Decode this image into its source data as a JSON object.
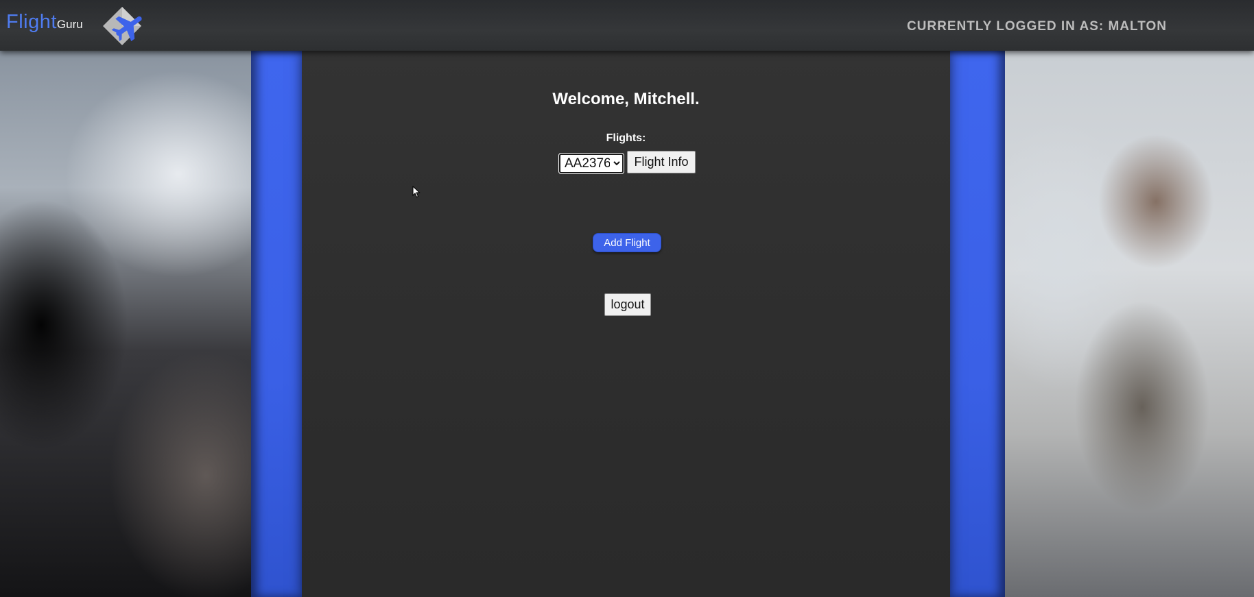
{
  "header": {
    "brand_main": "Flight",
    "brand_sub": "Guru",
    "logo_icon": "plane-logo-icon",
    "logged_in_text": "CURRENTLY LOGGED IN AS: MALTON"
  },
  "main": {
    "welcome": "Welcome, Mitchell.",
    "flights_label": "Flights:",
    "flight_select": {
      "selected": "AA2376",
      "options": [
        "AA2376"
      ]
    },
    "flight_info_label": "Flight Info",
    "add_flight_label": "Add Flight",
    "logout_label": "logout"
  },
  "colors": {
    "accent_blue": "#3d63ea",
    "brand_blue": "#4f7cf0",
    "panel_bg": "#2f2f2f",
    "header_bg": "#333537",
    "header_text": "#bdbdbd"
  }
}
